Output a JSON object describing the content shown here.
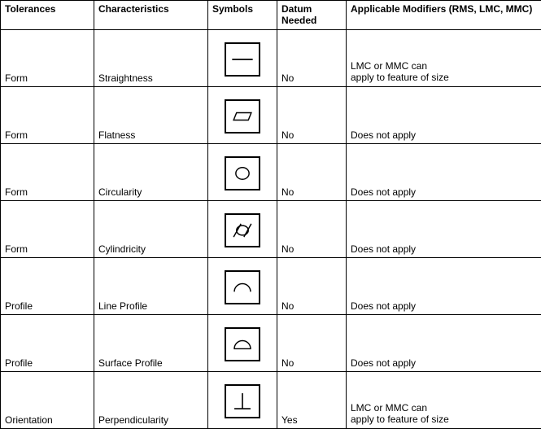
{
  "headers": {
    "tolerances": "Tolerances",
    "characteristics": "Characteristics",
    "symbols": "Symbols",
    "datum": "Datum Needed",
    "modifiers": "Applicable Modifiers (RMS, LMC, MMC)"
  },
  "rows": [
    {
      "tolerance": "Form",
      "characteristic": "Straightness",
      "symbol": "straightness",
      "datum": "No",
      "modifier_line1": "LMC or MMC can",
      "modifier_line2": "apply to feature of size"
    },
    {
      "tolerance": "Form",
      "characteristic": "Flatness",
      "symbol": "flatness",
      "datum": "No",
      "modifier_line1": "Does not apply",
      "modifier_line2": ""
    },
    {
      "tolerance": "Form",
      "characteristic": "Circularity",
      "symbol": "circularity",
      "datum": "No",
      "modifier_line1": "Does not apply",
      "modifier_line2": ""
    },
    {
      "tolerance": "Form",
      "characteristic": "Cylindricity",
      "symbol": "cylindricity",
      "datum": "No",
      "modifier_line1": "Does not apply",
      "modifier_line2": ""
    },
    {
      "tolerance": "Profile",
      "characteristic": "Line Profile",
      "symbol": "line-profile",
      "datum": "No",
      "modifier_line1": "Does not apply",
      "modifier_line2": ""
    },
    {
      "tolerance": "Profile",
      "characteristic": "Surface Profile",
      "symbol": "surface-profile",
      "datum": "No",
      "modifier_line1": "Does not apply",
      "modifier_line2": ""
    },
    {
      "tolerance": "Orientation",
      "characteristic": "Perpendicularity",
      "symbol": "perpendicularity",
      "datum": "Yes",
      "modifier_line1": "LMC or MMC can",
      "modifier_line2": "apply to feature of size"
    }
  ]
}
